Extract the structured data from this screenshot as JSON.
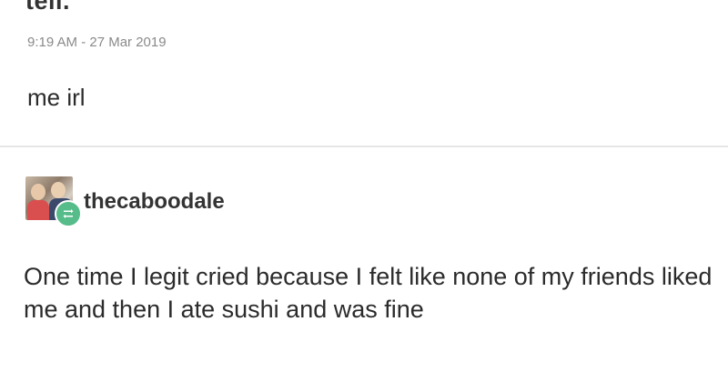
{
  "previous_post": {
    "cutoff_text": "tell.",
    "timestamp": "9:19 AM - 27 Mar 2019"
  },
  "reblog_comment": "me irl",
  "post": {
    "username": "thecaboodale",
    "body": "One time I legit cried because I felt like none of my friends liked me and then I ate sushi and was fine",
    "avatar_icon": "user-avatar-photo",
    "badge_icon": "reblog-icon",
    "badge_color": "#56bc8a"
  }
}
